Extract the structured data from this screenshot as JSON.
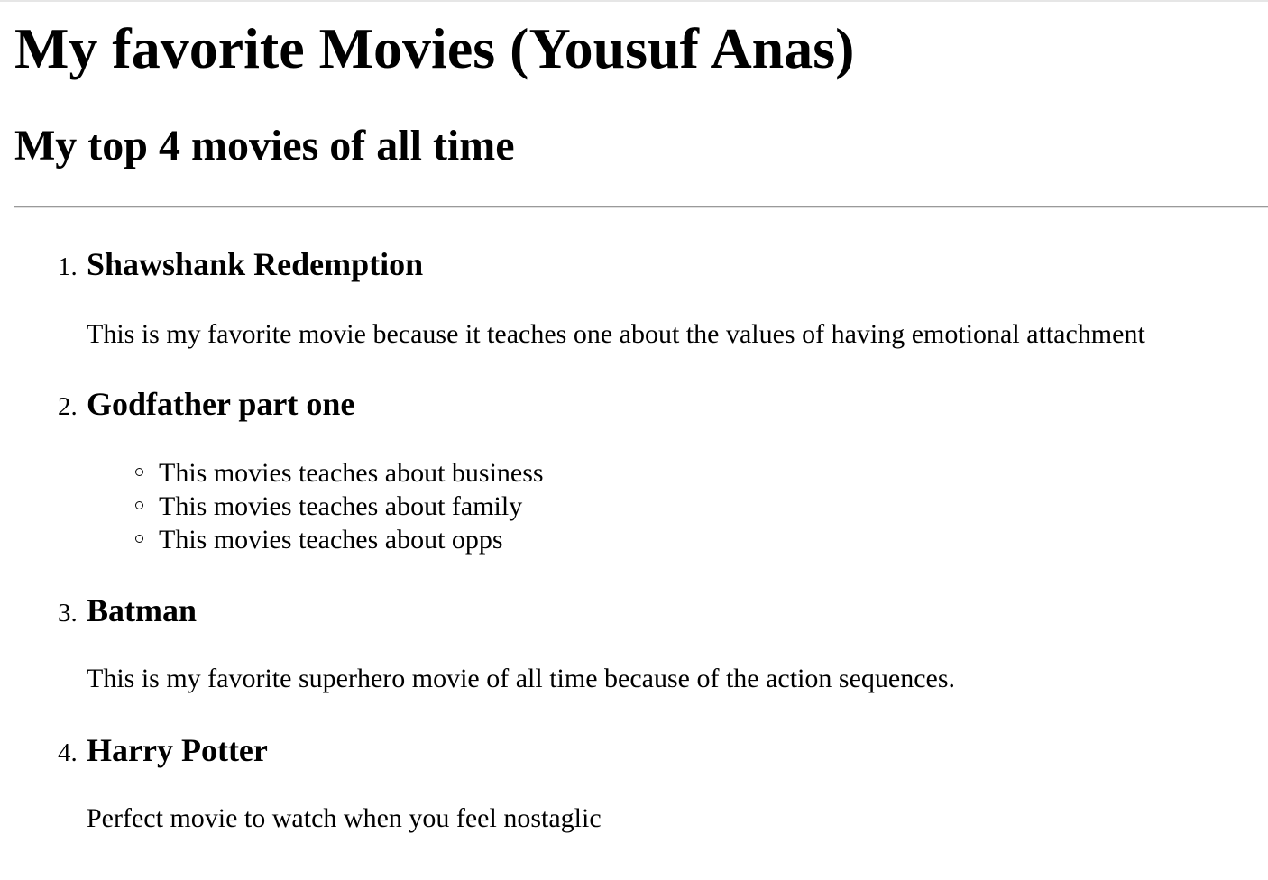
{
  "page": {
    "title": "My favorite Movies (Yousuf Anas)",
    "subtitle": "My top 4 movies of all time"
  },
  "movies": [
    {
      "number": "1.",
      "title": "Shawshank Redemption",
      "description": "This is my favorite movie because it teaches one about the values of having emotional attachment"
    },
    {
      "number": "2.",
      "title": "Godfather part one",
      "points": [
        "This movies teaches about business",
        "This movies teaches about family",
        "This movies teaches about opps"
      ]
    },
    {
      "number": "3.",
      "title": "Batman",
      "description": "This is my favorite superhero movie of all time because of the action sequences."
    },
    {
      "number": "4.",
      "title": "Harry Potter",
      "description": "Perfect movie to watch when you feel nostaglic"
    }
  ]
}
